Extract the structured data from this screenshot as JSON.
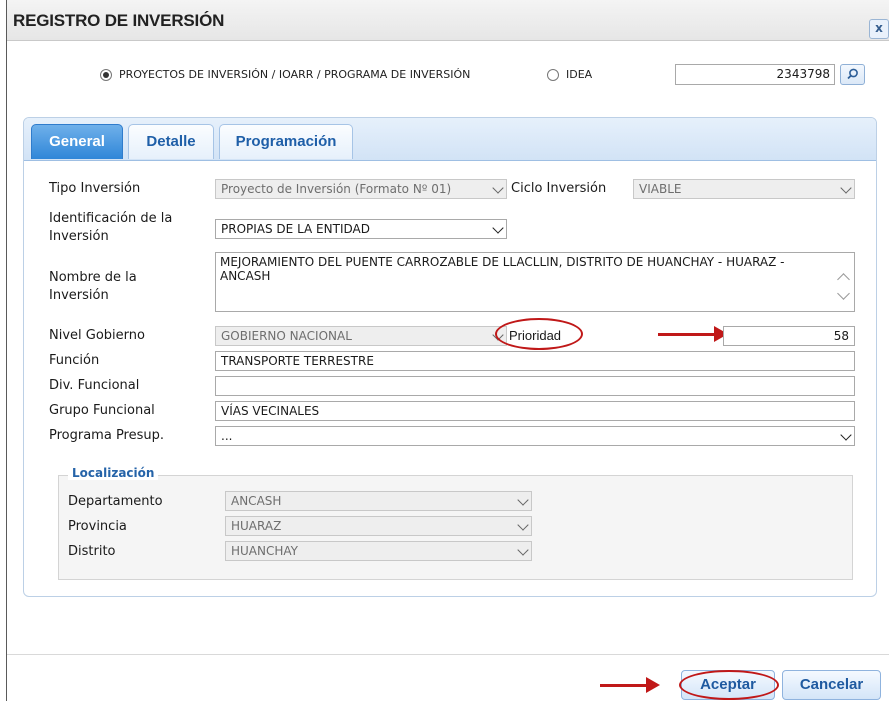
{
  "dialog": {
    "title": "REGISTRO DE INVERSIÓN",
    "close_label": "x"
  },
  "type_selector": {
    "option_projects": "PROYECTOS DE INVERSIÓN / IOARR / PROGRAMA DE INVERSIÓN",
    "option_idea": "IDEA",
    "selected": "PROYECTOS DE INVERSIÓN / IOARR / PROGRAMA DE INVERSIÓN",
    "code_value": "2343798"
  },
  "tabs": [
    {
      "label": "General",
      "active": true
    },
    {
      "label": "Detalle",
      "active": false
    },
    {
      "label": "Programación",
      "active": false
    }
  ],
  "form": {
    "tipo_inversion": {
      "label": "Tipo Inversión",
      "value": "Proyecto de Inversión (Formato Nº 01)"
    },
    "ciclo_inversion": {
      "label": "Ciclo Inversión",
      "value": "VIABLE"
    },
    "identificacion": {
      "label": "Identificación de la Inversión",
      "value": "PROPIAS DE LA ENTIDAD"
    },
    "nombre": {
      "label": "Nombre de la Inversión",
      "value": "MEJORAMIENTO DEL PUENTE CARROZABLE DE LLACLLIN, DISTRITO DE HUANCHAY - HUARAZ - ANCASH"
    },
    "nivel_gobierno": {
      "label": "Nivel Gobierno",
      "value": "GOBIERNO NACIONAL"
    },
    "prioridad": {
      "label": "Prioridad",
      "value": "58"
    },
    "funcion": {
      "label": "Función",
      "value": "TRANSPORTE TERRESTRE"
    },
    "div_funcional": {
      "label": "Div. Funcional",
      "value": ""
    },
    "grupo_funcional": {
      "label": "Grupo Funcional",
      "value": "VÍAS VECINALES"
    },
    "programa_presup": {
      "label": "Programa Presup.",
      "value": "..."
    }
  },
  "localizacion": {
    "legend": "Localización",
    "departamento": {
      "label": "Departamento",
      "value": "ANCASH"
    },
    "provincia": {
      "label": "Provincia",
      "value": "HUARAZ"
    },
    "distrito": {
      "label": "Distrito",
      "value": "HUANCHAY"
    }
  },
  "footer": {
    "accept_label": "Aceptar",
    "cancel_label": "Cancelar"
  },
  "colors": {
    "accent": "#2f86d8",
    "annotation": "#c01818"
  }
}
